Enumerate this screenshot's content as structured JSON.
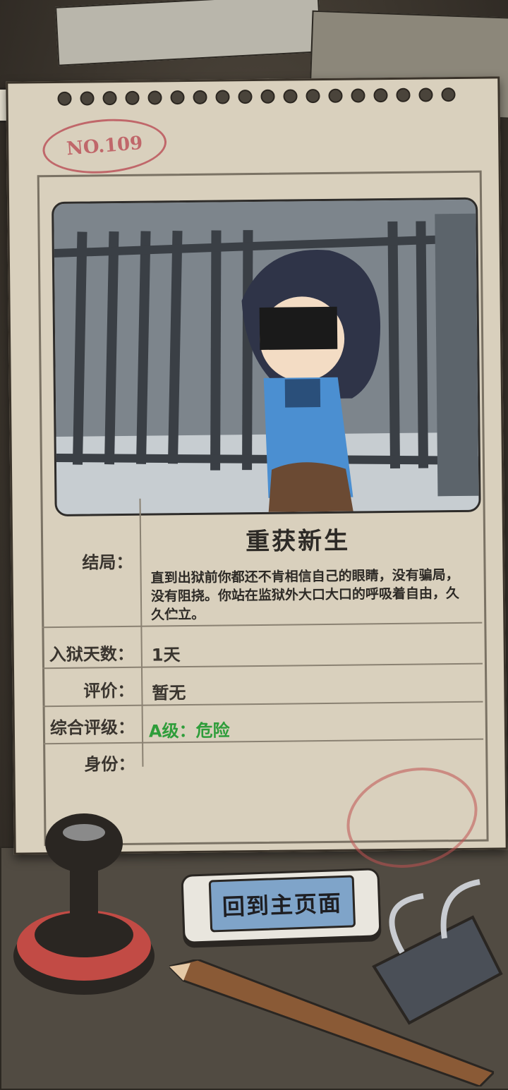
{
  "card": {
    "number": "NO.109",
    "ending_title": "重获新生",
    "rows": {
      "ending_label": "结局：",
      "ending_desc": "直到出狱前你都还不肯相信自己的眼睛，没有骗局，没有阻挠。你站在监狱外大口大口的呼吸着自由，久久伫立。",
      "days_label": "入狱天数：",
      "days_value": "1天",
      "rating_label": "评价：",
      "rating_value": "暂无",
      "grade_label": "综合评级：",
      "grade_value": "A级：危险",
      "identity_label": "身份：",
      "identity_value": ""
    }
  },
  "button": {
    "home_label": "回到主页面"
  },
  "colors": {
    "grade": "#2e9d3a",
    "stamp": "#c0676a",
    "button_blue": "#7fa4c9"
  }
}
